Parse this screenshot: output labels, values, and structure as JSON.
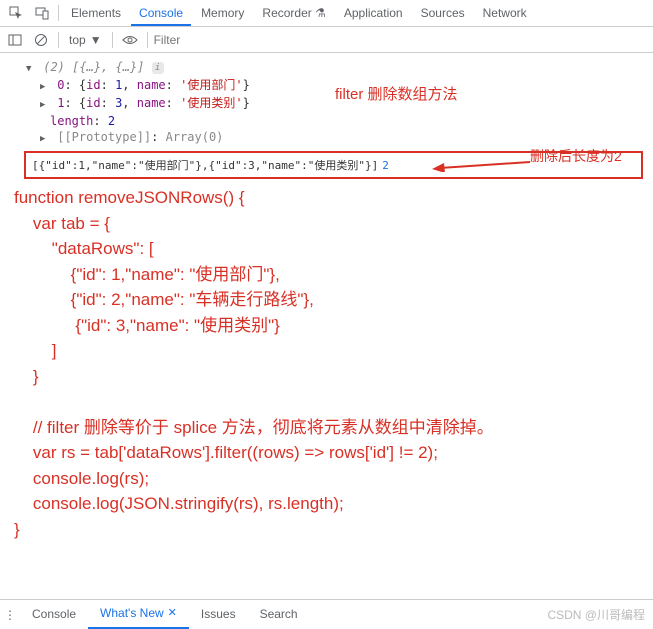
{
  "topTabs": {
    "items": [
      "Elements",
      "Console",
      "Memory",
      "Recorder",
      "Application",
      "Sources",
      "Network"
    ],
    "active": "Console",
    "recorderFlask": "⚗"
  },
  "toolbar": {
    "context": "top",
    "filterPlaceholder": "Filter"
  },
  "consoleLog": {
    "summary": "(2)",
    "summaryTail": "[{…}, {…}]",
    "rows": [
      {
        "idx": "0",
        "id": 1,
        "name": "使用部门"
      },
      {
        "idx": "1",
        "id": 3,
        "name": "使用类别"
      }
    ],
    "lengthLabel": "length",
    "lengthValue": 2,
    "protoLabel": "[[Prototype]]",
    "protoValue": "Array(0)",
    "boxed": "[{\"id\":1,\"name\":\"使用部门\"},{\"id\":3,\"name\":\"使用类别\"}]",
    "boxedLen": "2"
  },
  "annotations": {
    "a1": "filter 删除数组方法",
    "a2": "删除后长度为2"
  },
  "code": {
    "l1": "function removeJSONRows() {",
    "l2": "    var tab = {",
    "l3": "        \"dataRows\": [",
    "l4": "            {\"id\": 1,\"name\": \"使用部门\"},",
    "l5": "            {\"id\": 2,\"name\": \"车辆走行路线\"},",
    "l6": "             {\"id\": 3,\"name\": \"使用类别\"}",
    "l7": "        ]",
    "l8": "    }",
    "l9": "",
    "l10": "    // filter 删除等价于 splice 方法，彻底将元素从数组中清除掉。",
    "l11": "    var rs = tab['dataRows'].filter((rows) => rows['id'] != 2);",
    "l12": "    console.log(rs);",
    "l13": "    console.log(JSON.stringify(rs), rs.length);",
    "l14": "}"
  },
  "bottom": {
    "tabs": [
      "Console",
      "What's New",
      "Issues",
      "Search"
    ],
    "active": "What's New"
  },
  "watermark": "CSDN @川哥编程"
}
